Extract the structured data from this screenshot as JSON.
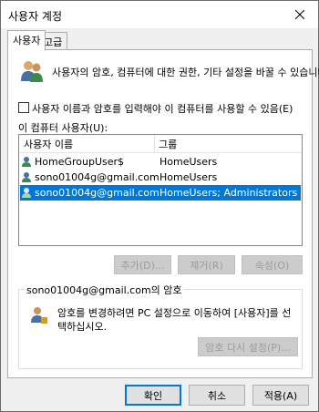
{
  "window": {
    "title": "사용자 계정"
  },
  "tabs": [
    {
      "label": "사용자"
    },
    {
      "label": "고급"
    }
  ],
  "intro_text": "사용자의 암호, 컴퓨터에 대한 권한, 기타 설정을 바꿀 수 있습니다.",
  "require_login": {
    "label": "사용자 이름과 암호를 입력해야 이 컴퓨터를 사용할 수 있음(E)",
    "checked": false
  },
  "users_list": {
    "label": "이 컴퓨터 사용자(U):",
    "columns": [
      "사용자 이름",
      "그룹"
    ],
    "rows": [
      {
        "name": "HomeGroupUser$",
        "group": "HomeUsers",
        "icon": "user-icon"
      },
      {
        "name": "sono01004g@gmail.com",
        "group": "HomeUsers",
        "icon": "user-icon"
      },
      {
        "name": "sono01004g@gmail.com",
        "group": "HomeUsers; Administrators",
        "icon": "user-icon",
        "selected": true
      }
    ]
  },
  "list_buttons": {
    "add": "추가(D)...",
    "remove": "제거(R)",
    "properties": "속성(O)"
  },
  "password_group": {
    "title": "sono01004g@gmail.com의 암호",
    "text": "암호를 변경하려면 PC 설정으로 이동하여 [사용자]를 선택하십시오.",
    "reset_button": "암호 다시 설정(P)..."
  },
  "footer": {
    "ok": "확인",
    "cancel": "취소",
    "apply": "적용(A)"
  }
}
